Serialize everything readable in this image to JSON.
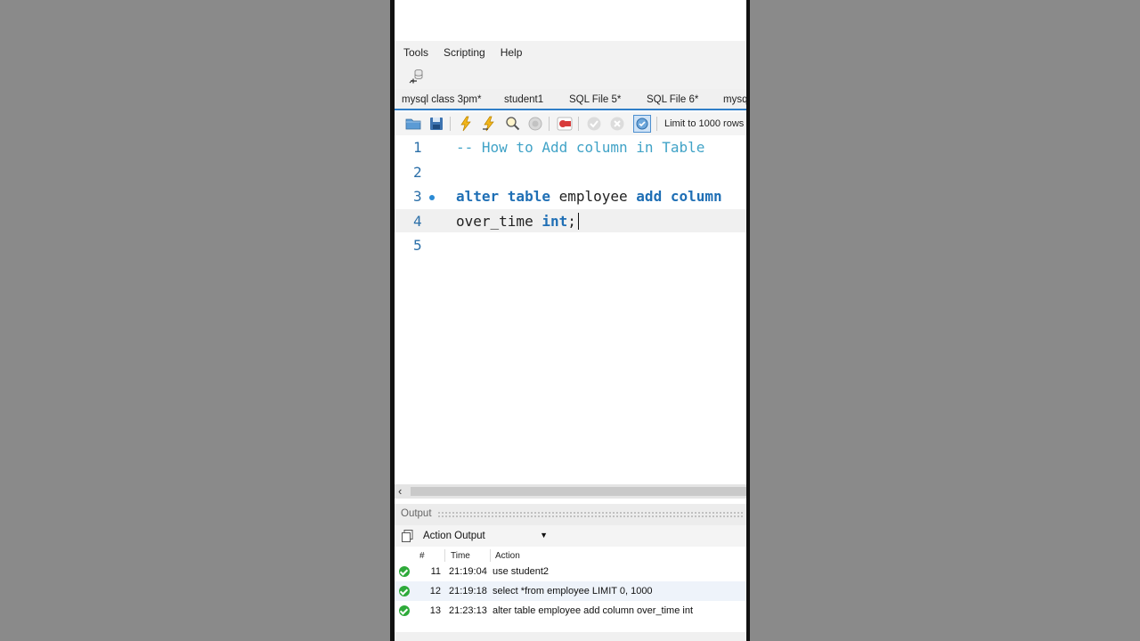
{
  "menu": {
    "items": [
      "Tools",
      "Scripting",
      "Help"
    ]
  },
  "tabs": [
    "mysql class 3pm*",
    "student1",
    "SQL File 5*",
    "SQL File 6*",
    "mysq"
  ],
  "toolbar": {
    "limit_label": "Limit to 1000 rows",
    "icons": [
      "open-file-icon",
      "save-icon",
      "execute-lightning-icon",
      "execute-current-icon",
      "explain-magnifier-icon",
      "stop-icon",
      "toggle-errors-icon",
      "commit-check-icon",
      "rollback-icon",
      "autocommit-icon"
    ]
  },
  "editor": {
    "lines": [
      {
        "number": "1",
        "tokens": [
          {
            "text": "-- How to Add column in Table",
            "kind": "comment"
          }
        ]
      },
      {
        "number": "2",
        "tokens": []
      },
      {
        "number": "3",
        "marker": true,
        "tokens": [
          {
            "text": "alter table",
            "kind": "keyword"
          },
          {
            "text": " employee ",
            "kind": "plain"
          },
          {
            "text": "add column",
            "kind": "keyword"
          }
        ]
      },
      {
        "number": "4",
        "current": true,
        "tokens": [
          {
            "text": "over_time ",
            "kind": "plain"
          },
          {
            "text": "int",
            "kind": "keyword"
          },
          {
            "text": ";",
            "kind": "plain"
          }
        ]
      },
      {
        "number": "5",
        "tokens": []
      }
    ]
  },
  "output": {
    "panel_title": "Output",
    "selector_value": "Action Output",
    "columns": [
      "#",
      "Time",
      "Action"
    ],
    "rows": [
      {
        "num": "11",
        "time": "21:19:04",
        "action": "use student2",
        "status": "success"
      },
      {
        "num": "12",
        "time": "21:19:18",
        "action": "select *from employee LIMIT 0, 1000",
        "status": "success"
      },
      {
        "num": "13",
        "time": "21:23:13",
        "action": "alter table employee add column over_time int",
        "status": "success"
      }
    ]
  },
  "colors": {
    "accent": "#2f7ec7",
    "keyword": "#1f6fb5",
    "comment": "#41a3c7",
    "line_number": "#2b6fa8",
    "success": "#2eaa3a"
  }
}
